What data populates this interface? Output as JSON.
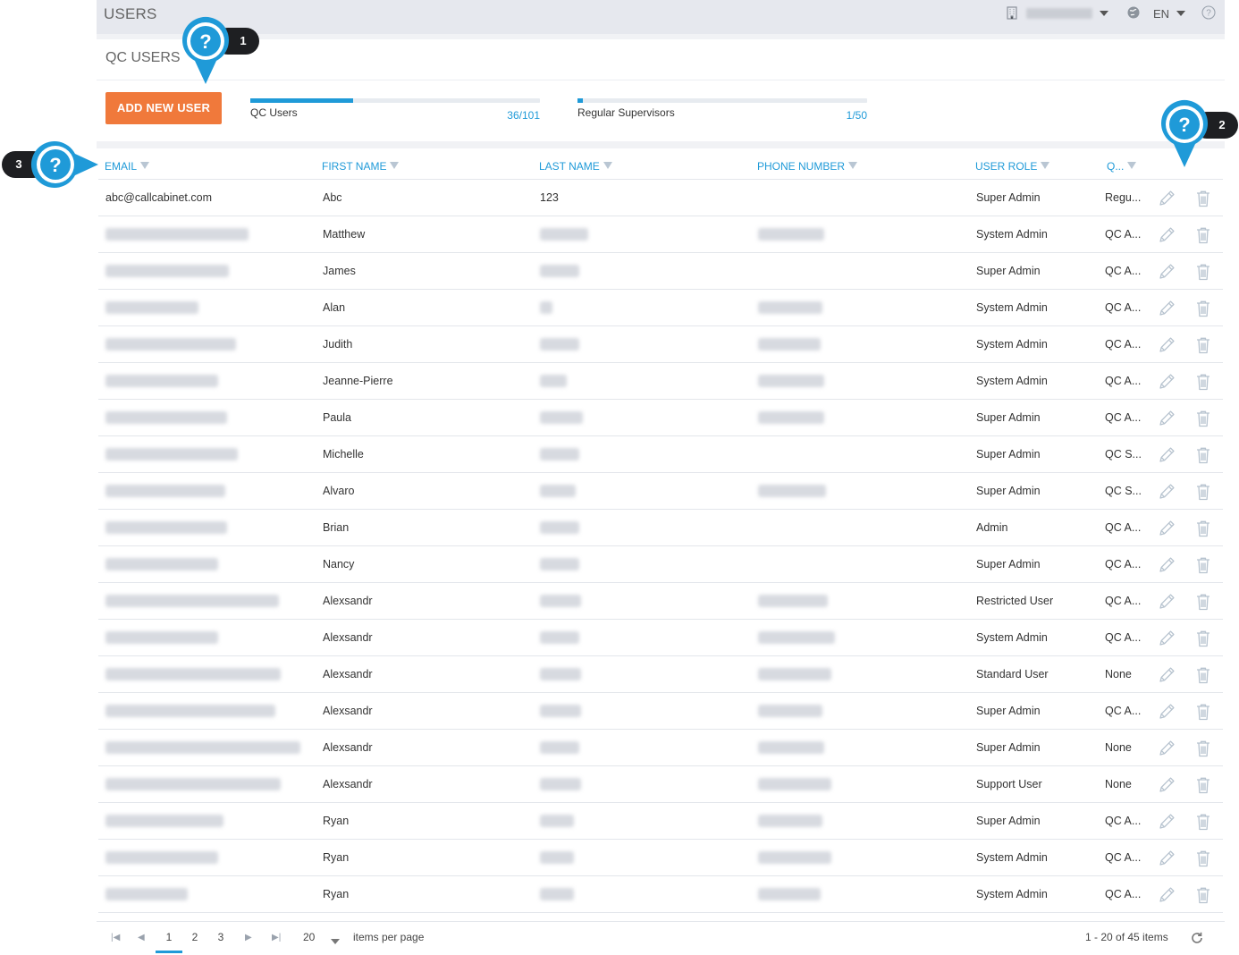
{
  "header": {
    "title": "USERS",
    "language": "EN"
  },
  "page": {
    "title": "QC USERS",
    "add_button": "ADD NEW USER",
    "quotas": [
      {
        "label": "QC Users",
        "count": "36/101",
        "fraction": 0.356
      },
      {
        "label": "Regular Supervisors",
        "count": "1/50",
        "fraction": 0.02
      }
    ]
  },
  "table": {
    "columns": [
      "EMAIL",
      "FIRST NAME",
      "LAST NAME",
      "PHONE NUMBER",
      "USER ROLE",
      "Q..."
    ],
    "rows": [
      {
        "email": "abc@callcabinet.com",
        "first": "Abc",
        "last": "123",
        "role": "Super Admin",
        "q": "Regu..."
      },
      {
        "email": "",
        "first": "Matthew",
        "last": "",
        "role": "System Admin",
        "q": "QC A..."
      },
      {
        "email": "",
        "first": "James",
        "last": "",
        "role": "Super Admin",
        "q": "QC A..."
      },
      {
        "email": "",
        "first": "Alan",
        "last": "",
        "role": "System Admin",
        "q": "QC A..."
      },
      {
        "email": "",
        "first": "Judith",
        "last": "",
        "role": "System Admin",
        "q": "QC A..."
      },
      {
        "email": "",
        "first": "Jeanne-Pierre",
        "last": "",
        "role": "System Admin",
        "q": "QC A..."
      },
      {
        "email": "",
        "first": "Paula",
        "last": "",
        "role": "Super Admin",
        "q": "QC A..."
      },
      {
        "email": "",
        "first": "Michelle",
        "last": "",
        "role": "Super Admin",
        "q": "QC S..."
      },
      {
        "email": "",
        "first": "Alvaro",
        "last": "",
        "role": "Super Admin",
        "q": "QC S..."
      },
      {
        "email": "",
        "first": "Brian",
        "last": "",
        "role": "Admin",
        "q": "QC A..."
      },
      {
        "email": "",
        "first": "Nancy",
        "last": "",
        "role": "Super Admin",
        "q": "QC A..."
      },
      {
        "email": "",
        "first": "Alexsandr",
        "last": "",
        "role": "Restricted User",
        "q": "QC A..."
      },
      {
        "email": "",
        "first": "Alexsandr",
        "last": "",
        "role": "System Admin",
        "q": "QC A..."
      },
      {
        "email": "",
        "first": "Alexsandr",
        "last": "",
        "role": "Standard User",
        "q": "None"
      },
      {
        "email": "",
        "first": "Alexsandr",
        "last": "",
        "role": "Super Admin",
        "q": "QC A..."
      },
      {
        "email": "",
        "first": "Alexsandr",
        "last": "",
        "role": "Super Admin",
        "q": "None"
      },
      {
        "email": "",
        "first": "Alexsandr",
        "last": "",
        "role": "Support User",
        "q": "None"
      },
      {
        "email": "",
        "first": "Ryan",
        "last": "",
        "role": "Super Admin",
        "q": "QC A..."
      },
      {
        "email": "",
        "first": "Ryan",
        "last": "",
        "role": "System Admin",
        "q": "QC A..."
      },
      {
        "email": "",
        "first": "Ryan",
        "last": "",
        "role": "System Admin",
        "q": "QC A..."
      }
    ]
  },
  "pager": {
    "pages": [
      "1",
      "2",
      "3"
    ],
    "current": "1",
    "page_size": "20",
    "per_page_label": "items per page",
    "summary": "1 - 20 of 45 items"
  },
  "help_markers": [
    "1",
    "2",
    "3"
  ],
  "icons": [
    "building-icon",
    "globe-icon",
    "help-circle-icon",
    "filter-icon",
    "pencil-icon",
    "trash-icon",
    "refresh-icon",
    "question-marker-icon"
  ],
  "colors": {
    "accent": "#1f9ad8",
    "button": "#f0793b",
    "badge": "#1e1f22"
  }
}
